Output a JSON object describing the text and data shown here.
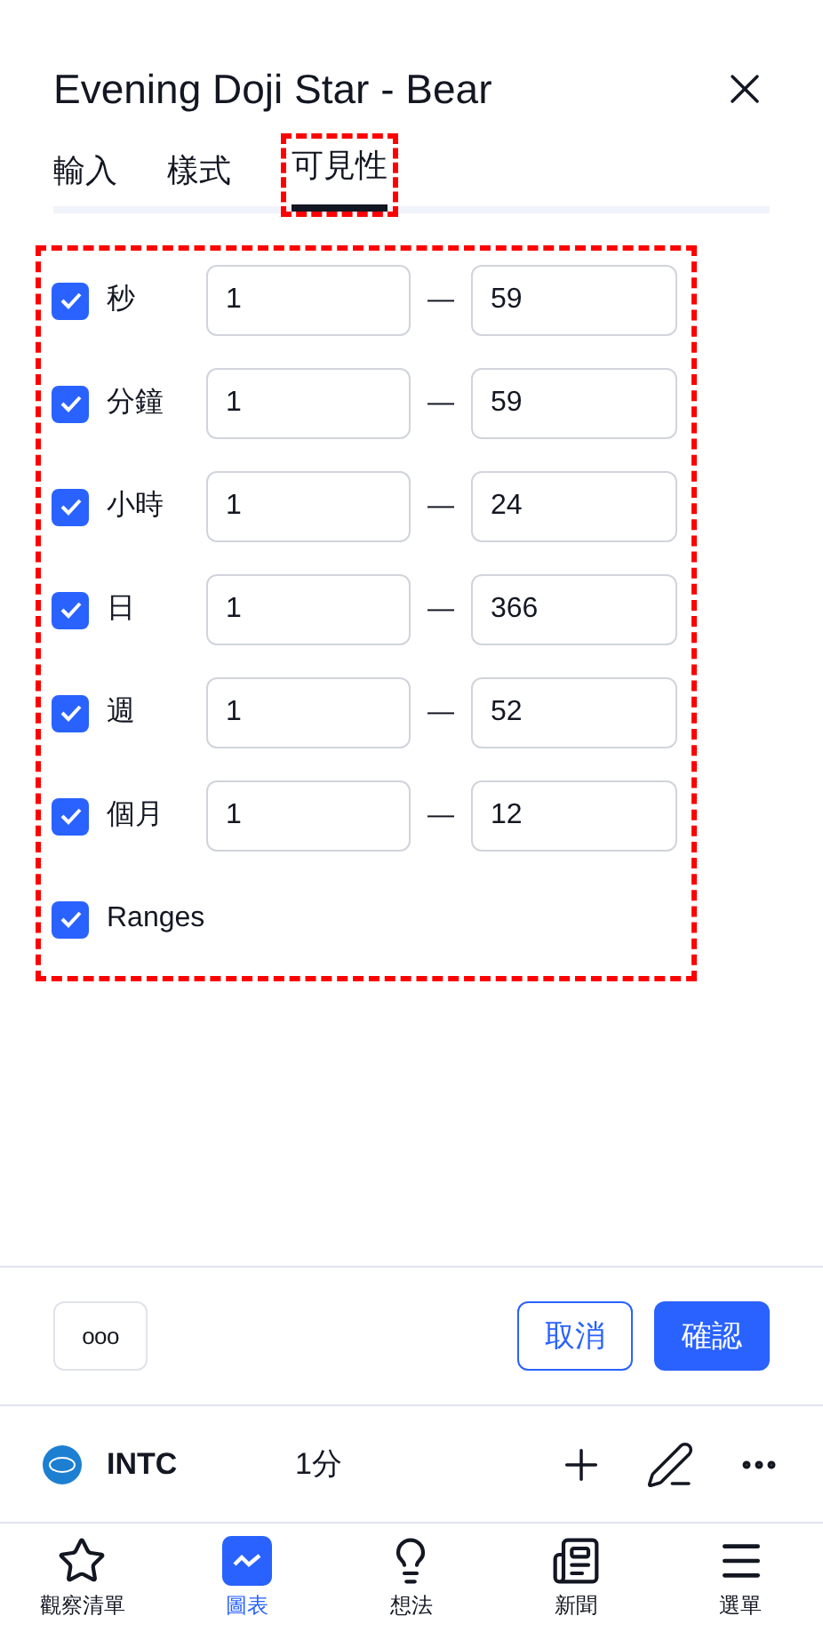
{
  "dialog": {
    "title": "Evening Doji Star - Bear",
    "tabs": [
      {
        "label": "輸入",
        "selected": false
      },
      {
        "label": "樣式",
        "selected": false
      },
      {
        "label": "可見性",
        "selected": true
      }
    ],
    "rows": [
      {
        "label": "秒",
        "checked": true,
        "from": "1",
        "to": "59",
        "kind": "range"
      },
      {
        "label": "分鐘",
        "checked": true,
        "from": "1",
        "to": "59",
        "kind": "range"
      },
      {
        "label": "小時",
        "checked": true,
        "from": "1",
        "to": "24",
        "kind": "range"
      },
      {
        "label": "日",
        "checked": true,
        "from": "1",
        "to": "366",
        "kind": "range"
      },
      {
        "label": "週",
        "checked": true,
        "from": "1",
        "to": "52",
        "kind": "range"
      },
      {
        "label": "個月",
        "checked": true,
        "from": "1",
        "to": "12",
        "kind": "range"
      },
      {
        "label": "Ranges",
        "checked": true,
        "kind": "plain"
      }
    ],
    "range_separator": "—",
    "more_button": "ooo",
    "cancel_button": "取消",
    "confirm_button": "確認"
  },
  "ticker_bar": {
    "symbol": "INTC",
    "interval": "1分"
  },
  "bottom_nav": [
    {
      "label": "觀察清單",
      "kind": "star",
      "selected": false
    },
    {
      "label": "圖表",
      "kind": "chart",
      "selected": true
    },
    {
      "label": "想法",
      "kind": "bulb",
      "selected": false
    },
    {
      "label": "新聞",
      "kind": "news",
      "selected": false
    },
    {
      "label": "選單",
      "kind": "menu",
      "selected": false
    }
  ]
}
